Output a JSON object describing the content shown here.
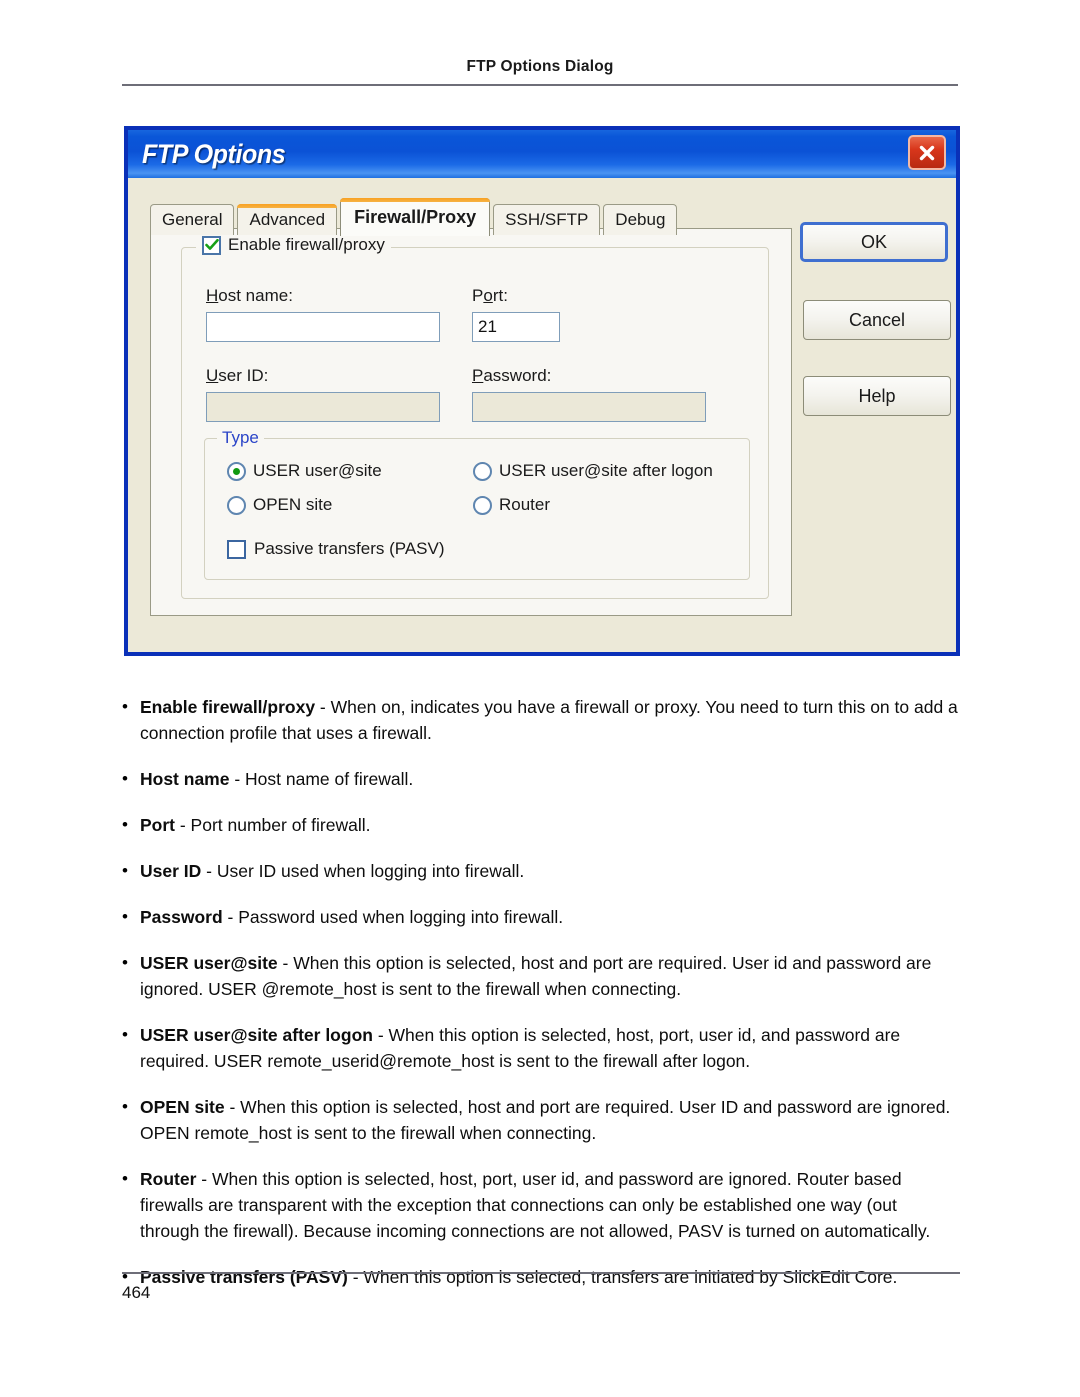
{
  "page": {
    "header_title": "FTP Options Dialog",
    "footer_page_number": "464"
  },
  "dialog": {
    "title": "FTP Options",
    "close_icon": "close-x-icon",
    "tabs": [
      {
        "label": "General",
        "selected": false,
        "accent": false
      },
      {
        "label": "Advanced",
        "selected": false,
        "accent": true
      },
      {
        "label": "Firewall/Proxy",
        "selected": true,
        "accent": true
      },
      {
        "label": "SSH/SFTP",
        "selected": false,
        "accent": false
      },
      {
        "label": "Debug",
        "selected": false,
        "accent": false
      }
    ],
    "buttons": {
      "ok": "OK",
      "cancel": "Cancel",
      "help": "Help"
    },
    "firewall_group": {
      "enable_label": "Enable firewall/proxy",
      "enable_checked": true,
      "host_name_label": "Host name:",
      "host_name_value": "",
      "port_label": "Port:",
      "port_value": "21",
      "user_id_label": "User ID:",
      "user_id_value": "",
      "user_id_disabled": true,
      "password_label": "Password:",
      "password_value": "",
      "password_disabled": true
    },
    "type_group": {
      "legend": "Type",
      "options": [
        {
          "label": "USER user@site",
          "selected": true
        },
        {
          "label": "USER user@site after logon",
          "selected": false
        },
        {
          "label": "OPEN site",
          "selected": false
        },
        {
          "label": "Router",
          "selected": false
        }
      ],
      "passive_label": "Passive transfers (PASV)",
      "passive_checked": false
    }
  },
  "bullets": [
    {
      "term": "Enable firewall/proxy",
      "rest": " - When on, indicates you have a firewall or proxy. You need to turn this on to add a connection profile that uses a firewall."
    },
    {
      "term": "Host name",
      "rest": " - Host name of firewall."
    },
    {
      "term": "Port",
      "rest": " - Port number of firewall."
    },
    {
      "term": "User ID",
      "rest": " - User ID used when logging into firewall."
    },
    {
      "term": "Password",
      "rest": " - Password used when logging into firewall."
    },
    {
      "term": "USER user@site",
      "rest": " - When this option is selected, host and port are required. User id and password are ignored. USER @remote_host is sent to the firewall when connecting."
    },
    {
      "term": "USER user@site after logon",
      "rest": " - When this option is selected, host, port, user id, and password are required. USER remote_userid@remote_host is sent to the firewall after logon."
    },
    {
      "term": "OPEN site",
      "rest": " - When this option is selected, host and port are required. User ID and password are ignored. OPEN remote_host is sent to the firewall when connecting."
    },
    {
      "term": "Router",
      "rest": " - When this option is selected, host, port, user id, and password are ignored. Router based firewalls are transparent with the exception that connections can only be established one way (out through the firewall). Because incoming connections are not allowed, PASV is turned on automatically."
    },
    {
      "term": "Passive transfers (PASV)",
      "rest": " - When this option is selected, transfers are initiated by SlickEdit Core."
    }
  ],
  "colors": {
    "titlebar_blue": "#0b52d6",
    "dialog_border": "#0a30b8",
    "dialog_face": "#ece9d8",
    "tab_accent_orange": "#f9a121",
    "group_legend_blue": "#2b45c8",
    "close_red": "#d8361b",
    "check_green": "#119911"
  }
}
